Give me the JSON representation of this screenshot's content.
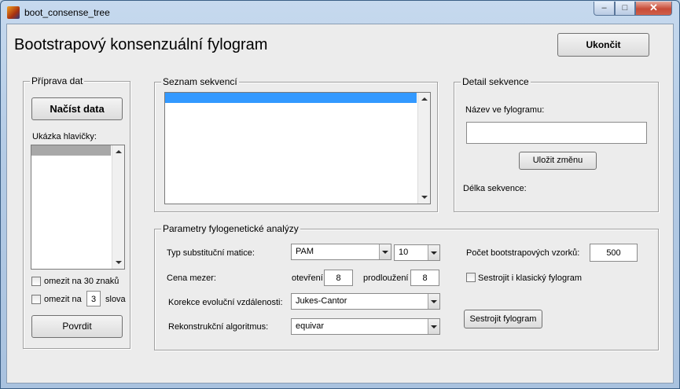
{
  "window": {
    "title": "boot_consense_tree",
    "min": "–",
    "max": "□",
    "close": "✕"
  },
  "header": {
    "title": "Bootstrapový konsenzuální fylogram",
    "quit_label": "Ukončit"
  },
  "prep": {
    "title": "Příprava dat",
    "load_label": "Načíst data",
    "header_label": "Ukázka hlavičky:",
    "limit30_label": "omezit na 30 znaků",
    "limit_words_prefix": "omezit na",
    "limit_words_value": "3",
    "limit_words_suffix": "slova",
    "confirm_label": "Povrdit"
  },
  "sequences": {
    "title": "Seznam sekvencí"
  },
  "detail": {
    "title": "Detail sekvence",
    "name_label": "Název ve fylogramu:",
    "name_value": "",
    "save_label": "Uložit změnu",
    "length_label": "Délka sekvence:"
  },
  "params": {
    "title": "Parametry fylogenetické analýzy",
    "matrix_label": "Typ substituční matice:",
    "matrix_value": "PAM",
    "matrix_num": "10",
    "gap_label": "Cena mezer:",
    "open_label": "otevření",
    "open_value": "8",
    "extend_label": "prodloužení",
    "extend_value": "8",
    "correction_label": "Korekce evoluční vzdálenosti:",
    "correction_value": "Jukes-Cantor",
    "algo_label": "Rekonstrukční algoritmus:",
    "algo_value": "equivar",
    "bootstrap_label": "Počet bootstrapových vzorků:",
    "bootstrap_value": "500",
    "classic_label": "Sestrojit i klasický fylogram",
    "build_label": "Sestrojit fylogram"
  }
}
